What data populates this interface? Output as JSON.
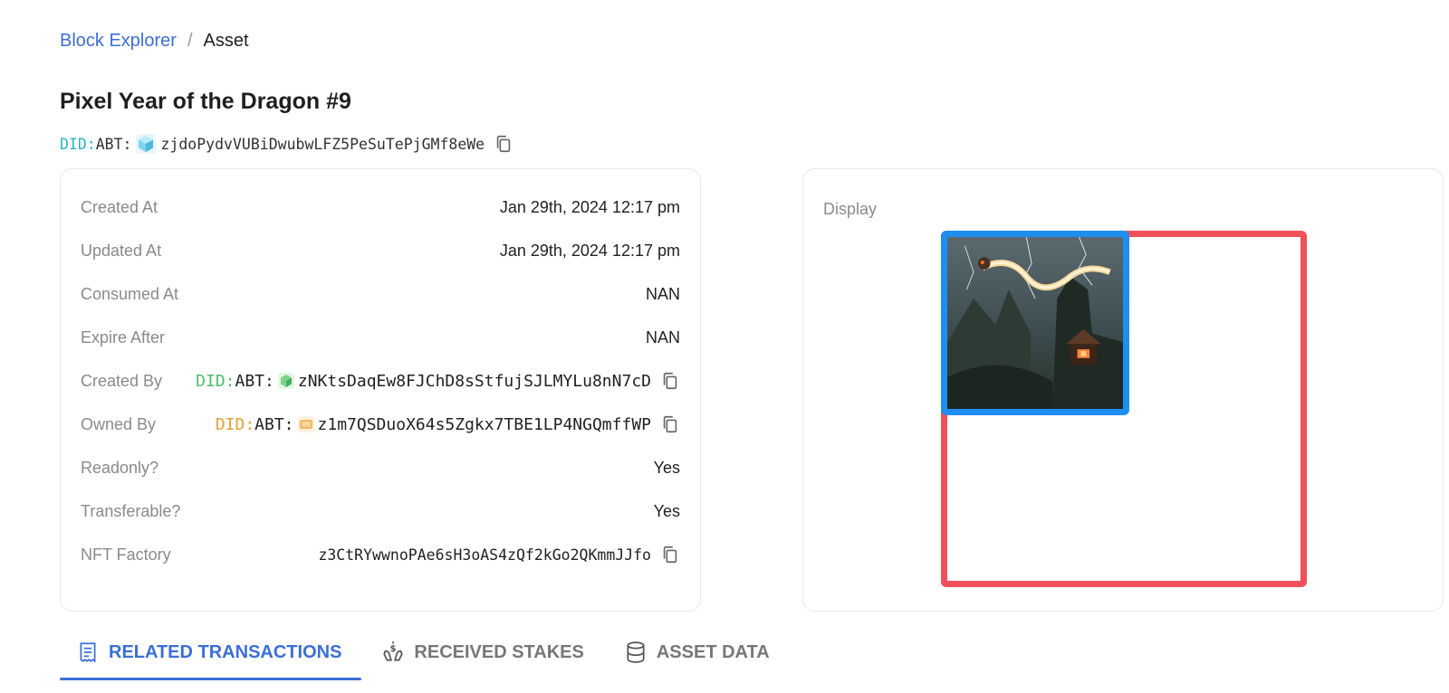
{
  "breadcrumb": {
    "root": "Block Explorer",
    "separator": "/",
    "current": "Asset"
  },
  "asset": {
    "title": "Pixel Year of the Dragon #9",
    "did_prefix": "DID:",
    "did_scheme": "ABT:",
    "address": "zjdoPydvVUBiDwubwLFZ5PeSuTePjGMf8eWe"
  },
  "info": {
    "created_at": {
      "label": "Created At",
      "value": "Jan 29th, 2024 12:17 pm"
    },
    "updated_at": {
      "label": "Updated At",
      "value": "Jan 29th, 2024 12:17 pm"
    },
    "consumed_at": {
      "label": "Consumed At",
      "value": "NAN"
    },
    "expire_after": {
      "label": "Expire After",
      "value": "NAN"
    },
    "created_by": {
      "label": "Created By",
      "did_prefix": "DID:",
      "did_scheme": "ABT:",
      "value": "zNKtsDaqEw8FJChD8sStfujSJLMYLu8nN7cD"
    },
    "owned_by": {
      "label": "Owned By",
      "did_prefix": "DID:",
      "did_scheme": "ABT:",
      "value": "z1m7QSDuoX64s5Zgkx7TBE1LP4NGQmffWP"
    },
    "readonly": {
      "label": "Readonly?",
      "value": "Yes"
    },
    "transferable": {
      "label": "Transferable?",
      "value": "Yes"
    },
    "nft_factory": {
      "label": "NFT Factory",
      "value": "z3CtRYwwnoPAe6sH3oAS4zQf2kGo2QKmmJJfo"
    }
  },
  "display": {
    "label": "Display"
  },
  "tabs": [
    {
      "label": "RELATED TRANSACTIONS",
      "icon": "receipt-icon",
      "active": true
    },
    {
      "label": "RECEIVED STAKES",
      "icon": "stake-hands-icon",
      "active": false
    },
    {
      "label": "ASSET DATA",
      "icon": "database-icon",
      "active": false
    }
  ],
  "colors": {
    "link": "#3b6fd6",
    "did_cyan": "#2bb3c0",
    "did_green": "#4bbf6b",
    "did_orange": "#e0a23a",
    "highlight_red": "#f0505a",
    "highlight_blue": "#1e8ef0"
  }
}
